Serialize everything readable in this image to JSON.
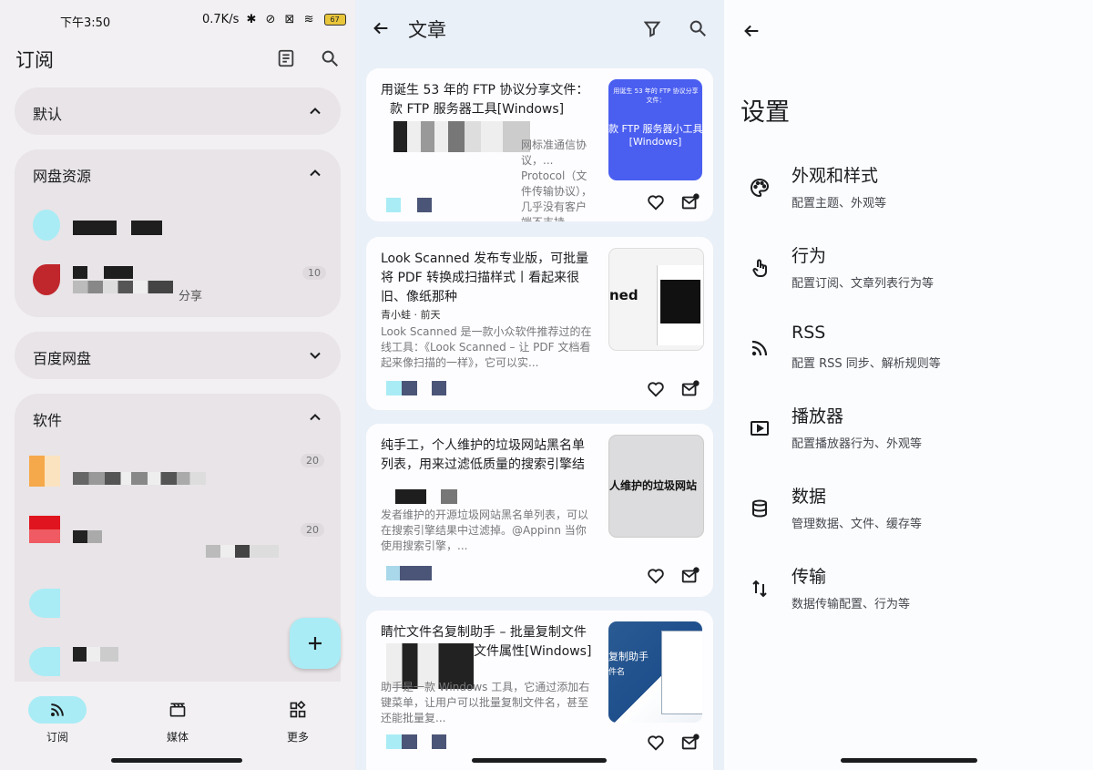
{
  "status_bar": {
    "time": "下午3:50",
    "net_speed": "0.7K/s",
    "battery": "67"
  },
  "subscribe": {
    "title": "订阅",
    "groups": [
      {
        "name": "默认"
      },
      {
        "name": "网盘资源",
        "feeds": [
          {
            "text": ""
          },
          {
            "text": "分享",
            "count": "10"
          }
        ]
      },
      {
        "name": "百度网盘"
      },
      {
        "name": "软件",
        "feeds": [
          {
            "count": "20"
          },
          {
            "count": "20"
          }
        ]
      }
    ],
    "nav": [
      {
        "label": "订阅"
      },
      {
        "label": "媒体"
      },
      {
        "label": "更多"
      }
    ]
  },
  "articles": {
    "title": "文章",
    "cards": [
      {
        "title": "用诞生 53 年的 FTP 协议分享文件：",
        "title2": "款 FTP 服务器工具[Windows]",
        "desc": "网标准通信协议，... Protocol（文件传输协议），几乎没有客户端不支持。...",
        "thumb_line1": "用诞生 53 年的 FTP 协议分享文件：",
        "thumb_line2": "款 FTP 服务器小工具",
        "thumb_line3": "[Windows]"
      },
      {
        "title": "Look Scanned 发布专业版，可批量将 PDF 转换成扫描样式丨看起来很旧、像纸那种",
        "author": "青小蛙 · 前天",
        "desc": "Look Scanned 是一款小众软件推荐过的在线工具：《Look Scanned – 让 PDF 文档看起来像扫描的一样》，它可以实...",
        "thumb_line1": "ned"
      },
      {
        "title": "纯手工，个人维护的垃圾网站黑名单列表，用来过滤低质量的搜索引擎结",
        "desc": "发者维护的开源垃圾网站黑名单列表，可以在搜索引擎结果中过滤掉。@Appinn 当你使用搜索引擎，...",
        "thumb_line1": "人维护的垃圾网站"
      },
      {
        "title": "睛忙文件名复制助手 – 批量复制文件",
        "title2": "文件属性[Windows]",
        "desc": "助手是一款 Windows 工具，它通过添加右键菜单，让用户可以批量复制文件名，甚至还能批量复...",
        "thumb_line1": "复制助手",
        "thumb_line2": "件名"
      }
    ]
  },
  "settings": {
    "title": "设置",
    "items": [
      {
        "title": "外观和样式",
        "sub": "配置主题、外观等",
        "icon": "palette-icon"
      },
      {
        "title": "行为",
        "sub": "配置订阅、文章列表行为等",
        "icon": "touch-icon"
      },
      {
        "title": "RSS",
        "sub": "配置 RSS 同步、解析规则等",
        "icon": "rss-icon"
      },
      {
        "title": "播放器",
        "sub": "配置播放器行为、外观等",
        "icon": "player-icon"
      },
      {
        "title": "数据",
        "sub": "管理数据、文件、缓存等",
        "icon": "database-icon"
      },
      {
        "title": "传输",
        "sub": "数据传输配置、行为等",
        "icon": "transfer-icon"
      }
    ]
  },
  "colors": {
    "accent": "#a9ecf5",
    "panel_subscribe": "#f2f0f2",
    "panel_articles": "#eaf0f7",
    "thumb_blue": "#4a5ef0"
  }
}
